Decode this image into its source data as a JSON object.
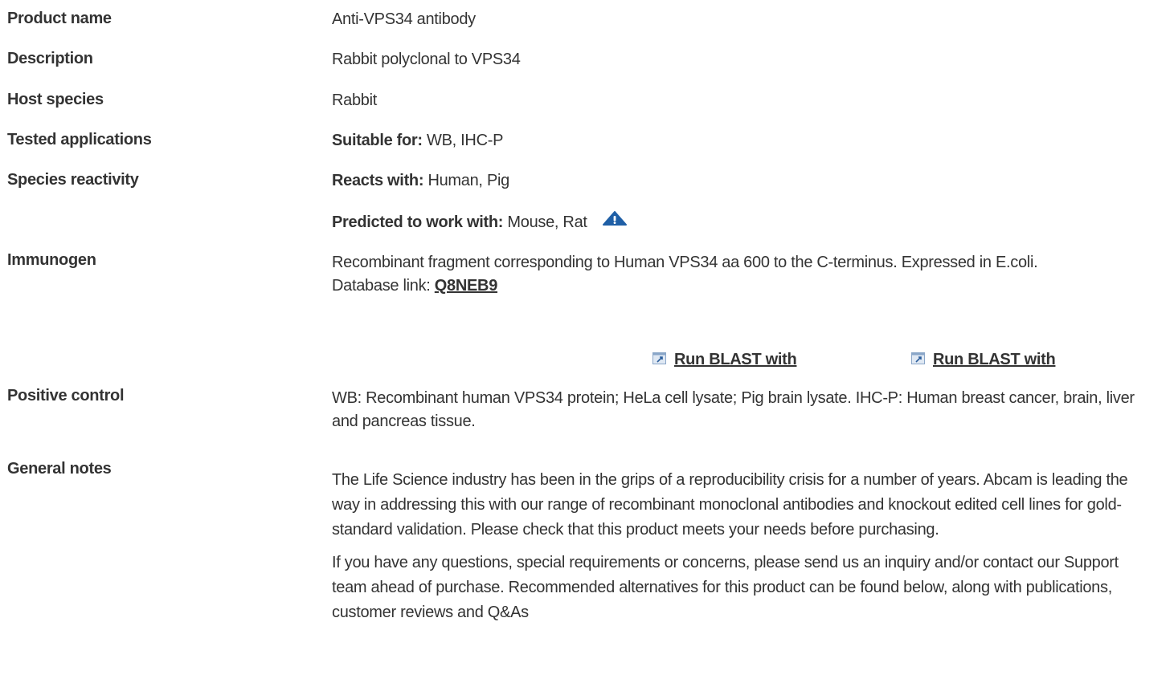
{
  "rows": [
    {
      "label": "Product name",
      "value": "Anti-VPS34 antibody"
    },
    {
      "label": "Description",
      "value": "Rabbit polyclonal to VPS34"
    },
    {
      "label": "Host species",
      "value": "Rabbit"
    },
    {
      "label": "Tested applications",
      "prefix": "Suitable for:",
      "value": " WB, IHC-P"
    },
    {
      "label": "Species reactivity",
      "prefix": "Reacts with:",
      "value": " Human, Pig"
    }
  ],
  "predicted": {
    "prefix": "Predicted to work with:",
    "value": " Mouse, Rat",
    "icon": "warning-triangle-icon",
    "icon_color": "#1f5fa6"
  },
  "immunogen": {
    "label": "Immunogen",
    "text": "Recombinant fragment corresponding to Human VPS34 aa 600 to the C-terminus. Expressed in E.coli.",
    "db_prefix": "Database link: ",
    "db_link": "Q8NEB9",
    "blast_1": "Run BLAST with",
    "blast_2": "Run BLAST with"
  },
  "positive_control": {
    "label": "Positive control",
    "text": "WB: Recombinant human VPS34 protein; HeLa cell lysate; Pig brain lysate. IHC-P: Human breast cancer, brain, liver and pancreas tissue."
  },
  "general_notes": {
    "label": "General notes",
    "para_1": "The Life Science industry has been in the grips of a reproducibility crisis for a number of years. Abcam is leading the way in addressing this with our range of recombinant monoclonal antibodies and knockout edited cell lines for gold-standard validation. Please check that this product meets your needs before purchasing.",
    "para_2": "If you have any questions, special requirements or concerns, please send us an inquiry and/or contact our Support team ahead of purchase. Recommended alternatives for this product can be found below, along with publications, customer reviews and Q&As"
  },
  "colors": {
    "text": "#333333",
    "icon_blue": "#1f5fa6",
    "background": "#ffffff"
  }
}
